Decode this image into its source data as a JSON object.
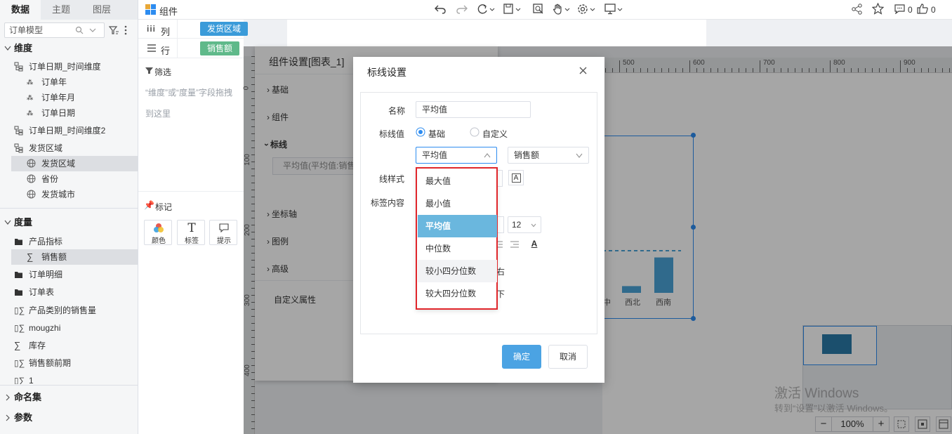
{
  "left_panel": {
    "tabs": [
      "数据",
      "主题",
      "图层"
    ],
    "model_select": "订单模型",
    "dimension_header": "维度",
    "dimensions": [
      {
        "label": "订单日期_时间维度",
        "kind": "hierarchy"
      },
      {
        "label": "订单年",
        "kind": "date"
      },
      {
        "label": "订单年月",
        "kind": "date"
      },
      {
        "label": "订单日期",
        "kind": "date"
      },
      {
        "label": "订单日期_时间维度2",
        "kind": "hierarchy"
      },
      {
        "label": "发货区域",
        "kind": "hierarchy"
      },
      {
        "label": "发货区域",
        "kind": "geo"
      },
      {
        "label": "省份",
        "kind": "geo"
      },
      {
        "label": "发货城市",
        "kind": "geo"
      }
    ],
    "measure_header": "度量",
    "measures": [
      {
        "label": "产品指标",
        "kind": "folder"
      },
      {
        "label": "销售额",
        "kind": "sum"
      },
      {
        "label": "订单明细",
        "kind": "folder"
      },
      {
        "label": "订单表",
        "kind": "folder"
      },
      {
        "label": "产品类别的销售量",
        "kind": "calc"
      },
      {
        "label": "mougzhi",
        "kind": "calc"
      },
      {
        "label": "库存",
        "kind": "sum"
      },
      {
        "label": "销售额前期",
        "kind": "calc"
      },
      {
        "label": "1",
        "kind": "calc"
      }
    ],
    "named_sets": "命名集",
    "params": "参数"
  },
  "shelf": {
    "column_label": "列",
    "row_label": "行",
    "column_pill": "发货区域",
    "row_pill": "销售额",
    "filter_title": "筛选",
    "filter_hint": "“维度”或“度量”字段拖拽到这里",
    "marks_title": "标记",
    "marks": [
      "颜色",
      "标签",
      "提示"
    ]
  },
  "toolbar": {
    "component_label": "组件",
    "comment_count": "0",
    "like_count": "0"
  },
  "settings_panel": {
    "title": "组件设置[图表_1]",
    "sections": [
      "基础",
      "组件",
      "标线",
      "坐标轴",
      "图例",
      "高级"
    ],
    "refline_item": "平均值(平均值:销售额)",
    "custom_attr": "自定义属性"
  },
  "ruler": {
    "top_ticks": [
      "500",
      "600",
      "700",
      "800",
      "900"
    ],
    "left_ticks": [
      "0",
      "100",
      "200",
      "300",
      "400"
    ]
  },
  "chart": {
    "categories_visible": [
      "中",
      "西北",
      "西南"
    ],
    "bar_color": "#4ba3d8",
    "bar_values": [
      0.08,
      0.42
    ],
    "avg_line_level": 0.5
  },
  "zoom": {
    "value": "100%"
  },
  "watermark": {
    "line1": "激活 Windows",
    "line2": "转到“设置”以激活 Windows。"
  },
  "dialog": {
    "title": "标线设置",
    "name_label": "名称",
    "name_value": "平均值",
    "value_label": "标线值",
    "radio_basic": "基础",
    "radio_custom": "自定义",
    "agg_select": "平均值",
    "field_select": "销售额",
    "line_style_label": "线样式",
    "label_content_label": "标签内容",
    "font_size": "12",
    "pos_right": "右",
    "pos_bottom": "下",
    "dropdown_options": [
      "最大值",
      "最小值",
      "平均值",
      "中位数",
      "较小四分位数",
      "较大四分位数"
    ],
    "selected_option": "平均值",
    "ok": "确定",
    "cancel": "取消"
  },
  "colors": {
    "accent": "#2d8cf0",
    "pill_blue": "#3a9bd9",
    "pill_green": "#5fb98a",
    "highlight_red": "#e0262b"
  }
}
